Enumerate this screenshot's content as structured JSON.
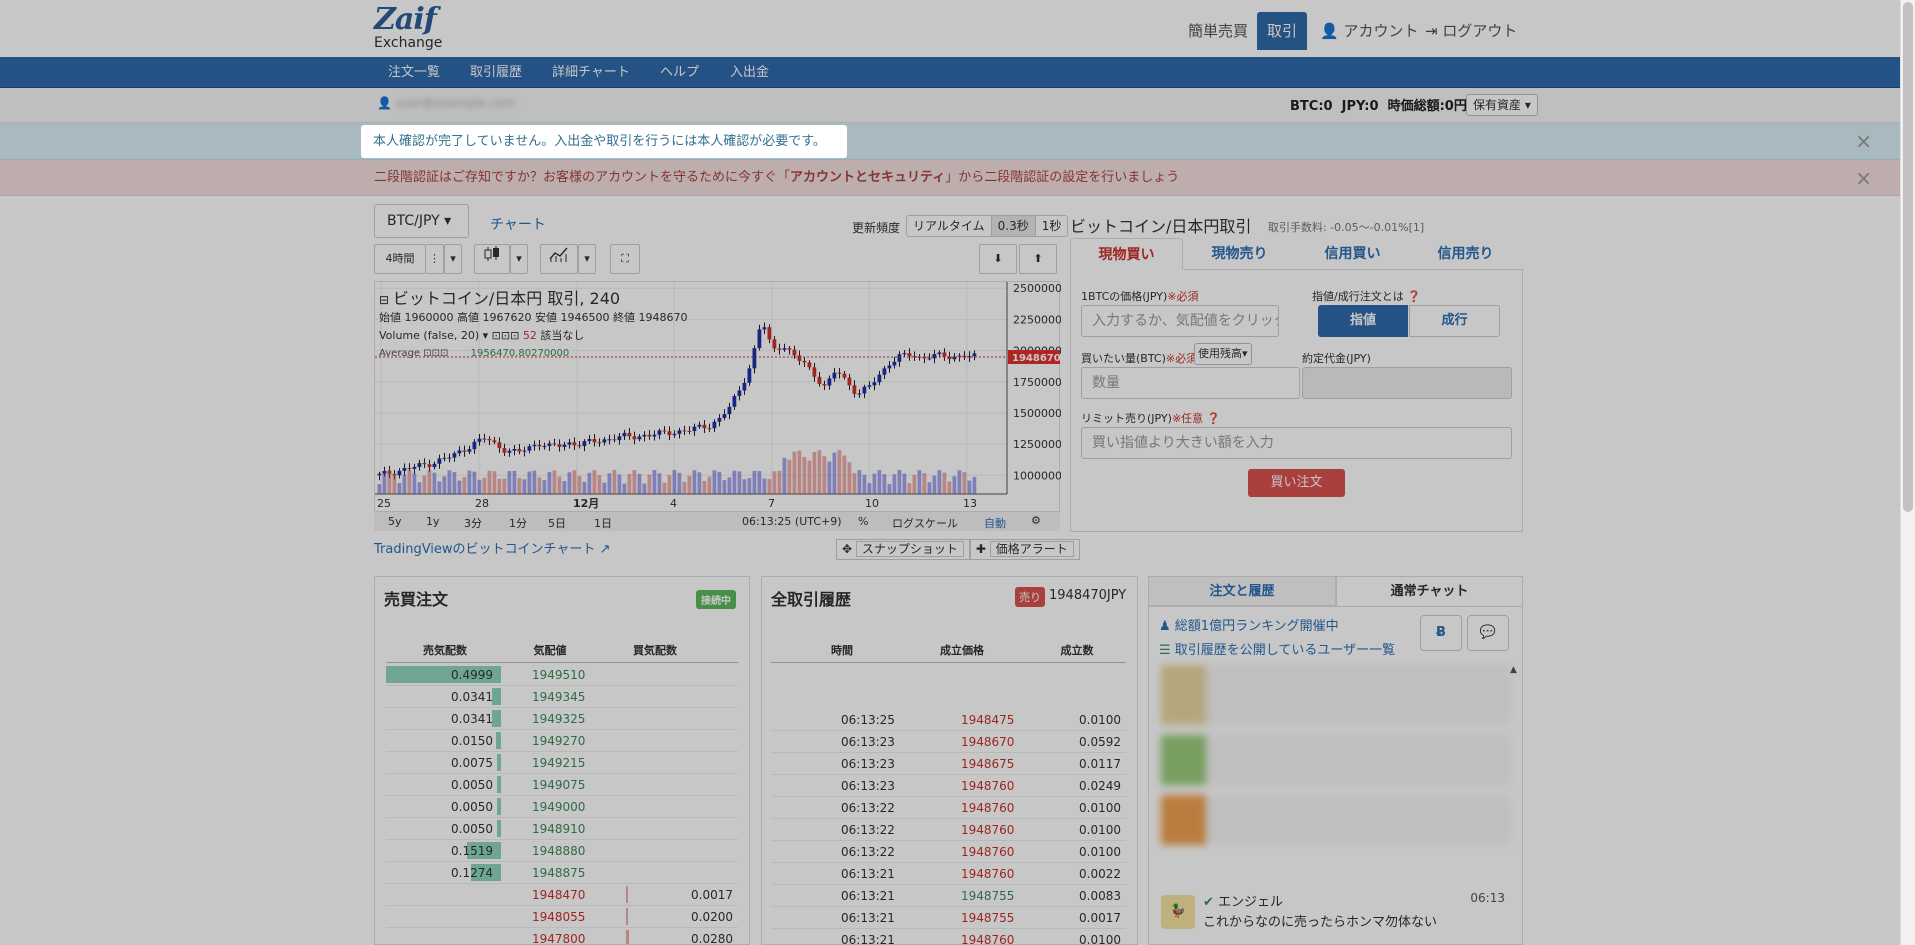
{
  "logo": {
    "main": "Zaif",
    "sub": "Exchange"
  },
  "topnav": {
    "easy": "簡単売買",
    "trade": "取引",
    "account": "アカウント",
    "logout": "ログアウト"
  },
  "subnav": [
    "注文一覧",
    "取引履歴",
    "詳細チャート",
    "ヘルプ",
    "入出金"
  ],
  "user": {
    "email": "user@example.com"
  },
  "balance": {
    "btc_label": "BTC:",
    "btc": "0",
    "jpy_label": "JPY:",
    "jpy": "0",
    "total_label": "時価総額:",
    "total": "0円",
    "holdings_btn": "保有資産"
  },
  "alerts": {
    "info": "本人確認が完了していません。入出金や取引を行うには本人確認が必要です。",
    "two_factor_pre": "二段階認証はご存知ですか？お客様のアカウントを守るために今すぐ「",
    "two_factor_bold": "アカウントとセキュリティ",
    "two_factor_post": "」から二段階認証の設定を行いましょう"
  },
  "chart": {
    "pair": "BTC/JPY",
    "tab": "チャート",
    "freq_label": "更新頻度",
    "freq_options": [
      "リアルタイム",
      "0.3秒",
      "1秒"
    ],
    "freq_selected": "0.3秒",
    "interval": "4時間",
    "title": "ビットコイン/日本円 取引, 240",
    "ohlc": {
      "open_label": "始値",
      "open": "1960000",
      "high_label": "高値",
      "high": "1967620",
      "low_label": "安値",
      "low": "1946500",
      "close_label": "終値",
      "close": "1948670"
    },
    "volume_label": "Volume (false, 20)",
    "volume_value": "52",
    "volume_note": "該当なし",
    "avg_label": "Average",
    "avg_value": "1956470.80270000",
    "last_price": "1948670",
    "range_buttons": [
      "5y",
      "1y",
      "3分",
      "1分",
      "5日",
      "1日"
    ],
    "time": "06:13:25 (UTC+9)",
    "scale_opts": [
      "%",
      "ログスケール",
      "自動"
    ],
    "tv_link": "TradingViewのビットコインチャート",
    "snapshot": "スナップショット",
    "price_alert": "価格アラート"
  },
  "chart_data": {
    "type": "candlestick",
    "y_ticks": [
      2500000,
      2250000,
      2000000,
      1750000,
      1500000,
      1250000,
      1000000
    ],
    "x_ticks": [
      "25",
      "28",
      "12月",
      "4",
      "7",
      "10",
      "13"
    ],
    "ylim": [
      850000,
      2550000
    ],
    "last_price": 1948670,
    "close_series": [
      1000000,
      1020000,
      1040000,
      1060000,
      1080000,
      1100000,
      1130000,
      1160000,
      1210000,
      1260000,
      1300000,
      1240000,
      1200000,
      1180000,
      1220000,
      1260000,
      1230000,
      1240000,
      1260000,
      1250000,
      1270000,
      1280000,
      1300000,
      1310000,
      1310000,
      1320000,
      1330000,
      1340000,
      1350000,
      1360000,
      1380000,
      1400000,
      1450000,
      1550000,
      1700000,
      1900000,
      2250000,
      2000000,
      2050000,
      1950000,
      1900000,
      1800000,
      1700000,
      1850000,
      1750000,
      1650000,
      1700000,
      1800000,
      1900000,
      1950000,
      1970000,
      1940000,
      1960000,
      1955000,
      1950000,
      1960000,
      1948670
    ]
  },
  "trade": {
    "title": "ビットコイン/日本円取引",
    "fee": "取引手数料: -0.05〜-0.01%[1]",
    "tabs": [
      "現物買い",
      "現物売り",
      "信用買い",
      "信用売り"
    ],
    "price_label": "1BTCの価格(JPY)",
    "required": "※必須",
    "price_placeholder": "入力するか、気配値をクリック",
    "order_type_label": "指値/成行注文とは",
    "limit": "指値",
    "market": "成行",
    "amount_label": "買いたい量(BTC)",
    "use_balance": "使用残高",
    "contract_label": "約定代金(JPY)",
    "amount_placeholder": "数量",
    "limit_sell_label": "リミット売り(JPY)",
    "optional": "※任意",
    "limit_sell_placeholder": "買い指値より大きい額を入力",
    "buy_btn": "買い注文"
  },
  "orderbook": {
    "title": "売買注文",
    "badge": "接続中",
    "headers": [
      "売気配数",
      "気配値",
      "買気配数"
    ],
    "asks": [
      {
        "amount": "0.4999",
        "price": "1949510",
        "fill": 1.0
      },
      {
        "amount": "0.0341",
        "price": "1949345",
        "fill": 0.08
      },
      {
        "amount": "0.0341",
        "price": "1949325",
        "fill": 0.08
      },
      {
        "amount": "0.0150",
        "price": "1949270",
        "fill": 0.04
      },
      {
        "amount": "0.0075",
        "price": "1949215",
        "fill": 0.03
      },
      {
        "amount": "0.0050",
        "price": "1949075",
        "fill": 0.02
      },
      {
        "amount": "0.0050",
        "price": "1949000",
        "fill": 0.02
      },
      {
        "amount": "0.0050",
        "price": "1948910",
        "fill": 0.02
      },
      {
        "amount": "0.1519",
        "price": "1948880",
        "fill": 0.3
      },
      {
        "amount": "0.1274",
        "price": "1948875",
        "fill": 0.26
      }
    ],
    "bids": [
      {
        "amount": "0.0017",
        "price": "1948470",
        "fill": 0.02
      },
      {
        "amount": "0.0200",
        "price": "1948055",
        "fill": 0.04
      },
      {
        "amount": "0.0280",
        "price": "1947800",
        "fill": 0.05
      }
    ]
  },
  "trades": {
    "title": "全取引履歴",
    "badge": "売り",
    "last": "1948470JPY",
    "headers": [
      "時間",
      "成立価格",
      "成立数"
    ],
    "rows": [
      {
        "time": "06:13:25",
        "price": "1948475",
        "amount": "0.0100",
        "side": "sell"
      },
      {
        "time": "06:13:23",
        "price": "1948670",
        "amount": "0.0592",
        "side": "sell"
      },
      {
        "time": "06:13:23",
        "price": "1948675",
        "amount": "0.0117",
        "side": "sell"
      },
      {
        "time": "06:13:23",
        "price": "1948760",
        "amount": "0.0249",
        "side": "sell"
      },
      {
        "time": "06:13:22",
        "price": "1948760",
        "amount": "0.0100",
        "side": "sell"
      },
      {
        "time": "06:13:22",
        "price": "1948760",
        "amount": "0.0100",
        "side": "sell"
      },
      {
        "time": "06:13:22",
        "price": "1948760",
        "amount": "0.0100",
        "side": "sell"
      },
      {
        "time": "06:13:21",
        "price": "1948760",
        "amount": "0.0022",
        "side": "sell"
      },
      {
        "time": "06:13:21",
        "price": "1948755",
        "amount": "0.0083",
        "side": "buy"
      },
      {
        "time": "06:13:21",
        "price": "1948755",
        "amount": "0.0017",
        "side": "sell"
      },
      {
        "time": "06:13:21",
        "price": "1948760",
        "amount": "0.0100",
        "side": "sell"
      }
    ]
  },
  "chat": {
    "tabs": [
      "注文と履歴",
      "通常チャット"
    ],
    "ranking": "総額1億円ランキング開催中",
    "public_users": "取引履歴を公開しているユーザー一覧",
    "last_msg": {
      "name": "エンジェル",
      "time": "06:13",
      "text": "これからなのに売ったらホンマ勿体ない"
    }
  },
  "colors": {
    "brand": "#2f6aab",
    "sell": "#c9302c",
    "buy": "#3c8a5a",
    "ask_fill": "#8fd4bf",
    "bid_fill": "#f0a8a8"
  }
}
